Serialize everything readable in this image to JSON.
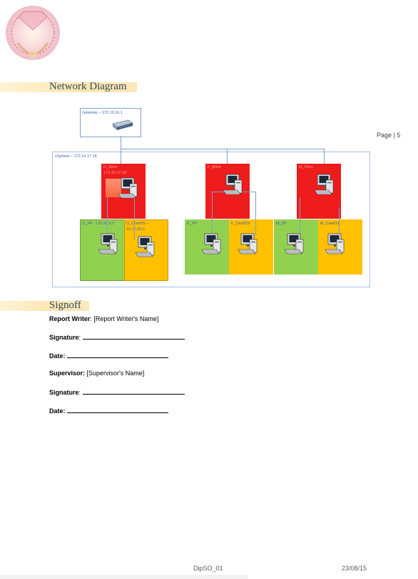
{
  "header": {
    "page_label": "Page | 5"
  },
  "sections": {
    "network": {
      "title": "Network Diagram"
    },
    "signoff": {
      "title": "Signoff"
    }
  },
  "diagram": {
    "gateway_label": "Gateway – 172.16.16.1",
    "vsphere_label": "vSphere – 172.16.17.18",
    "nodes": {
      "d_winx": "D_Winx",
      "d_winx_ip": "172.16.17.20",
      "d_xp": "D_XP - 172.20.0.2",
      "d_centos": "D_CentOS –",
      "d_centos_ip": "10.10.10.2",
      "f_winx": "F_Winx",
      "f_xp": "F_XP",
      "f_centos": "F_CentOS",
      "m_winx": "M_Winx",
      "m_xp": "M_XP",
      "m_centos": "M_CentOS"
    },
    "colors": {
      "red": "#ee1c1c",
      "green": "#92d050",
      "yellow": "#ffc000",
      "line": "#7da2c9"
    }
  },
  "signoff": {
    "report_writer_label": "Report Writer",
    "report_writer_value": ": [Report Writer's Name]",
    "signature_label": "Signature",
    "date_label": "Date:",
    "supervisor_label": "Supervisor:",
    "supervisor_value": " [Supervisor's Name]",
    "colon": ":"
  },
  "footer": {
    "doc_code": "DipSO_01",
    "date": "23/08/15"
  }
}
